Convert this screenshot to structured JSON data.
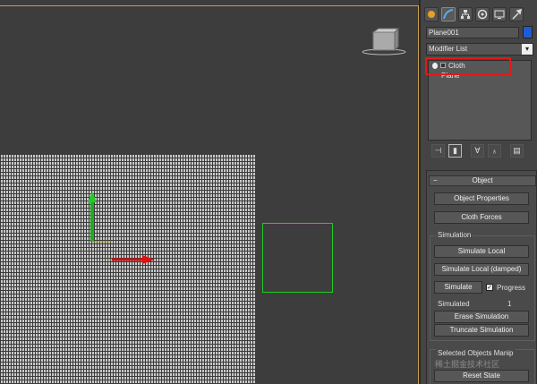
{
  "command_panel": {
    "tabs": [
      {
        "icon": "create-icon"
      },
      {
        "icon": "modify-icon"
      },
      {
        "icon": "hierarchy-icon"
      },
      {
        "icon": "motion-icon"
      },
      {
        "icon": "display-icon"
      },
      {
        "icon": "utilities-icon"
      }
    ],
    "object_name": "Plane001",
    "object_color": "#1e5bd6",
    "modifier_list_label": "Modifier List",
    "stack": [
      {
        "label": "Cloth",
        "highlighted": true
      },
      {
        "label": "Plane"
      }
    ]
  },
  "rollout": {
    "title": "Object",
    "collapse_symbol": "−",
    "buttons": {
      "object_properties": "Object Properties",
      "cloth_forces": "Cloth Forces",
      "simulate_local": "Simulate Local",
      "simulate_local_damped": "Simulate Local (damped)",
      "simulate": "Simulate",
      "erase_simulation": "Erase Simulation",
      "truncate_simulation": "Truncate Simulation",
      "reset_state": "Reset State"
    },
    "simulation_group_label": "Simulation",
    "progress_label": "Progress",
    "progress_checked": true,
    "simulated_label": "Simulated",
    "simulated_value": "1",
    "selected_objects_label": "Selected Objects Manip"
  },
  "watermark": "稀土掘金技术社区",
  "colors": {
    "highlight": "#e01a1a",
    "selection_box": "#22cc22",
    "viewport_border": "#c8a050"
  }
}
